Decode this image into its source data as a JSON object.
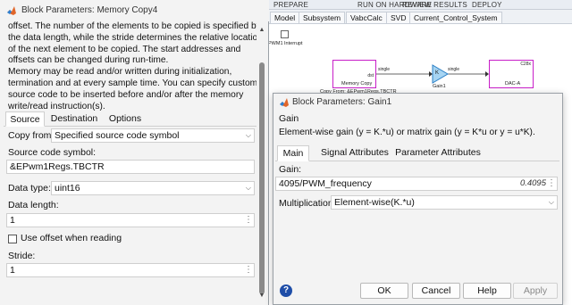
{
  "ribbon": {
    "left_label": "PREPARE",
    "mid_label": "RUN ON HARDWARE",
    "review_label": "REVIEW RESULTS",
    "deploy_label": "DEPLOY"
  },
  "model_tabs": [
    "Model",
    "Subsystem",
    "VabcCalc",
    "SVD",
    "Current_Control_System"
  ],
  "canvas": {
    "pwm_interrupt": "PWM1 Interrupt",
    "memory_copy_block": "Memory Copy",
    "memory_copy_port": "dst",
    "memory_copy_caption": "Copy From: &EPwm1Regs.TBCTR",
    "signal1": "single",
    "signal2": "single",
    "gain_block_glyph": "K",
    "gain_name": "Gain1",
    "dac_block": "DAC-A",
    "dac_badge": "C28x"
  },
  "dialog1": {
    "title": "Block Parameters: Memory Copy4",
    "description": "offset. The number of the elements to be copied is specified by\nthe data length, while the stride determines the relative location\nof the next element to be copied. The start addresses and\noffsets can be changed during run-time.\nMemory may be read and/or written during initialization,\ntermination and at every sample time. You can specify custom C\nsource code to be inserted before and/or after the memory\nwrite/read instruction(s).",
    "tabs": [
      "Source",
      "Destination",
      "Options"
    ],
    "copy_from_label": "Copy from:",
    "copy_from_value": "Specified source code symbol",
    "source_symbol_label": "Source code symbol:",
    "source_symbol_value": "&EPwm1Regs.TBCTR",
    "data_type_label": "Data type:",
    "data_type_value": "uint16",
    "data_length_label": "Data length:",
    "data_length_value": "1",
    "use_offset_label": "Use offset when reading",
    "use_offset_checked": false,
    "stride_label": "Stride:",
    "stride_value": "1"
  },
  "dialog2": {
    "title": "Block Parameters: Gain1",
    "section": "Gain",
    "description": "Element-wise gain (y = K.*u) or matrix gain (y = K*u or y = u*K).",
    "tabs": [
      "Main",
      "Signal Attributes",
      "Parameter Attributes"
    ],
    "gain_label": "Gain:",
    "gain_value": "4095/PWM_frequency",
    "gain_evaluated": "0.4095",
    "multiplication_label": "Multiplication:",
    "multiplication_value": "Element-wise(K.*u)",
    "buttons": {
      "ok": "OK",
      "cancel": "Cancel",
      "help": "Help",
      "apply": "Apply"
    },
    "help_icon": "?"
  },
  "colors": {
    "block_magenta": "#c81ec8",
    "gain_fill": "#a6d4f2",
    "gain_stroke": "#2a7fc6",
    "help_blue": "#1f4ea8"
  }
}
